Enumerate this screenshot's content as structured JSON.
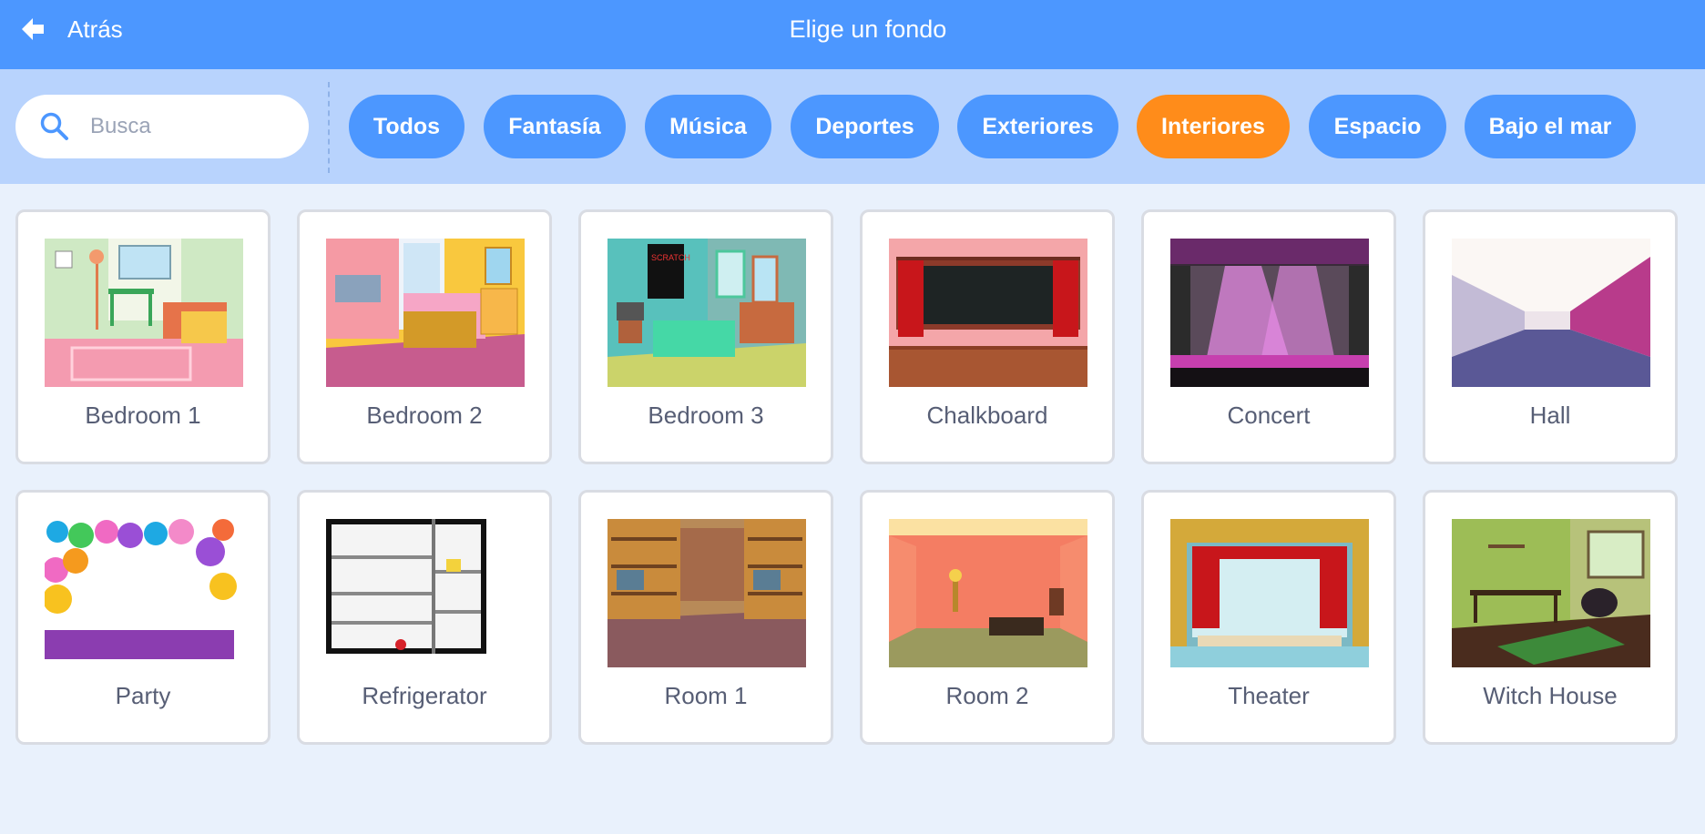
{
  "header": {
    "back_label": "Atrás",
    "title": "Elige un fondo"
  },
  "search": {
    "placeholder": "Busca",
    "value": ""
  },
  "tags": [
    {
      "label": "Todos",
      "active": false
    },
    {
      "label": "Fantasía",
      "active": false
    },
    {
      "label": "Música",
      "active": false
    },
    {
      "label": "Deportes",
      "active": false
    },
    {
      "label": "Exteriores",
      "active": false
    },
    {
      "label": "Interiores",
      "active": true
    },
    {
      "label": "Espacio",
      "active": false
    },
    {
      "label": "Bajo el mar",
      "active": false
    }
  ],
  "backdrops": [
    {
      "name": "Bedroom 1"
    },
    {
      "name": "Bedroom 2"
    },
    {
      "name": "Bedroom 3"
    },
    {
      "name": "Chalkboard"
    },
    {
      "name": "Concert"
    },
    {
      "name": "Hall"
    },
    {
      "name": "Party"
    },
    {
      "name": "Refrigerator"
    },
    {
      "name": "Room 1"
    },
    {
      "name": "Room 2"
    },
    {
      "name": "Theater"
    },
    {
      "name": "Witch House"
    }
  ],
  "colors": {
    "header": "#4c97ff",
    "filter_bar": "#b8d3fd",
    "active_tag": "#ff8c1a",
    "tag": "#4c97ff",
    "background": "#e9f1fc"
  },
  "icons": {
    "back": "back-arrow-icon",
    "search": "search-icon"
  }
}
